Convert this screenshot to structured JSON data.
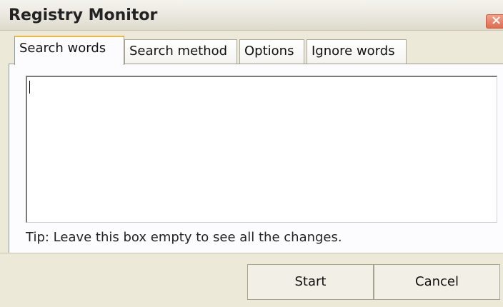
{
  "window": {
    "title": "Registry Monitor",
    "close_icon": "close-icon"
  },
  "tabs": [
    {
      "label": "Search words",
      "active": true
    },
    {
      "label": "Search method",
      "active": false
    },
    {
      "label": "Options",
      "active": false
    },
    {
      "label": "Ignore words",
      "active": false
    }
  ],
  "search": {
    "value": "",
    "tip": "Tip: Leave this box empty to see all the changes."
  },
  "buttons": {
    "start_label": "Start",
    "cancel_label": "Cancel"
  },
  "colors": {
    "window_bg": "#ece9d8",
    "active_tab_accent": "#f0b83c",
    "close_button": "#e06b50"
  }
}
